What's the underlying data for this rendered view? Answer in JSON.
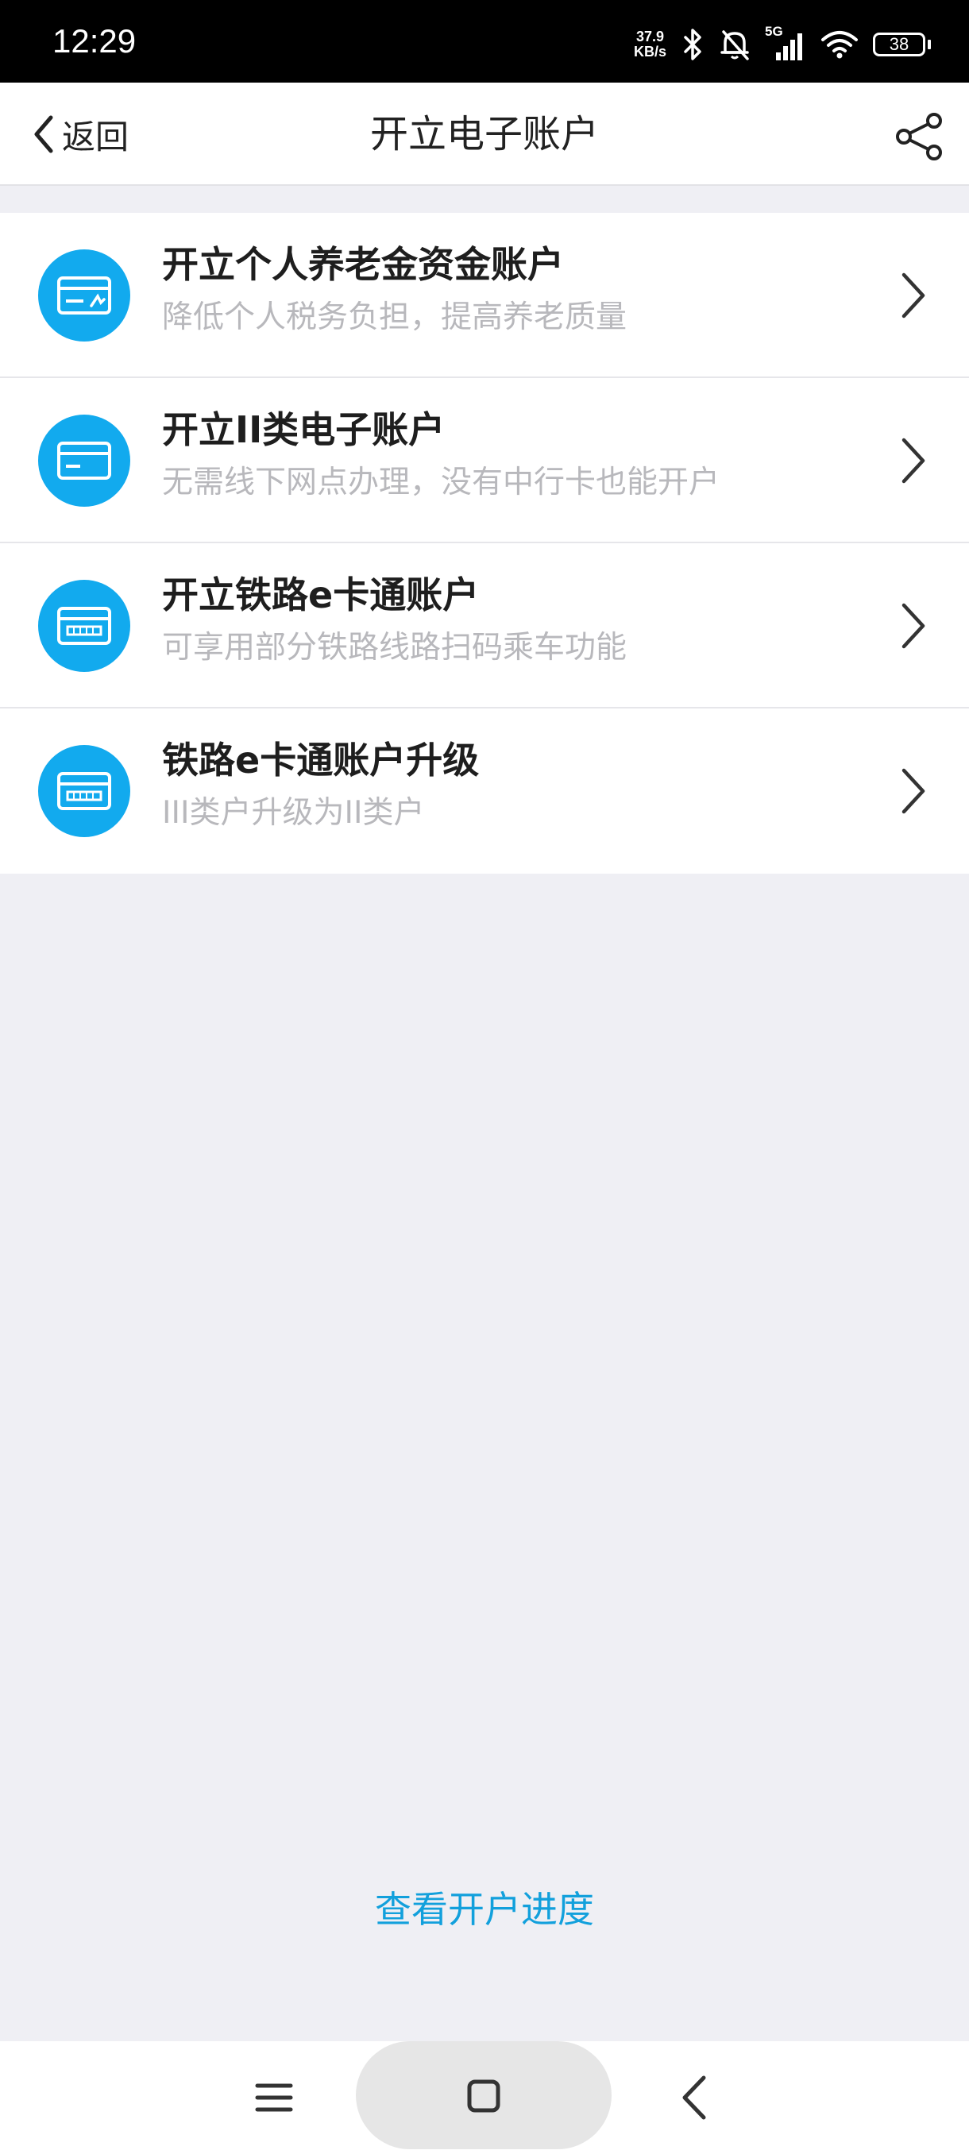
{
  "status_bar": {
    "time": "12:29",
    "net_speed_value": "37.9",
    "net_speed_unit": "KB/s",
    "network": "5G",
    "battery": "38"
  },
  "nav": {
    "back_label": "返回",
    "title": "开立电子账户"
  },
  "items": [
    {
      "title": "开立个人养老金资金账户",
      "subtitle": "降低个人税务负担，提高养老质量",
      "icon": "pension-card-icon"
    },
    {
      "title": "开立II类电子账户",
      "subtitle": "无需线下网点办理，没有中行卡也能开户",
      "icon": "bank-card-icon"
    },
    {
      "title": "开立铁路e卡通账户",
      "subtitle": "可享用部分铁路线路扫码乘车功能",
      "icon": "rail-card-icon"
    },
    {
      "title": "铁路e卡通账户升级",
      "subtitle": "III类户升级为II类户",
      "icon": "rail-card-icon"
    }
  ],
  "footer_link": "查看开户进度",
  "colors": {
    "accent": "#12aaee",
    "link": "#12a0dc",
    "background": "#efeff4"
  }
}
